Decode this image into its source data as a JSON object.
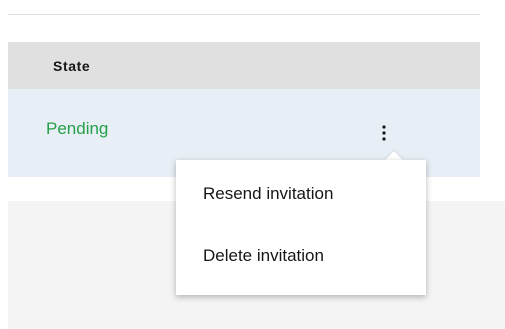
{
  "table": {
    "columns": [
      {
        "label": "State"
      }
    ],
    "rows": [
      {
        "state": "Pending",
        "state_color": "#24a148"
      }
    ]
  },
  "overflow_menu": {
    "icon": "overflow-menu-vertical-icon",
    "items": [
      {
        "label": "Resend invitation"
      },
      {
        "label": "Delete invitation"
      }
    ]
  }
}
